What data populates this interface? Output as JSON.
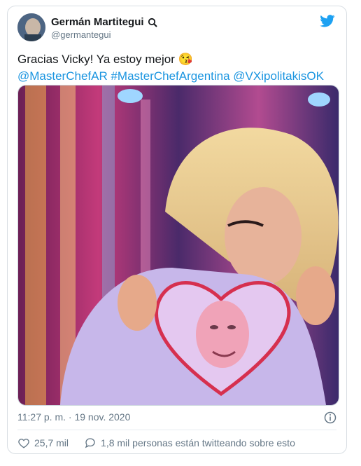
{
  "tweet": {
    "author_name": "Germán Martitegui",
    "author_handle": "@germantegui",
    "text_line1": "Gracias Vicky! Ya estoy mejor 😘",
    "text_line2": "@MasterChefAR #MasterChefArgentina @VXipolitakisOK",
    "timestamp": "11:27 p. m. · 19 nov. 2020",
    "likes": "25,7 mil",
    "conversation": "1,8 mil personas están twitteando sobre esto"
  },
  "icons": {
    "verified": "magnifier-badge-icon",
    "twitter": "twitter-bird-icon",
    "info": "info-icon",
    "like": "heart-icon",
    "reply": "reply-bubble-icon"
  },
  "colors": {
    "link": "#1b95e0",
    "twitter_blue": "#1da1f2",
    "muted": "#657786",
    "text": "#14171a"
  }
}
